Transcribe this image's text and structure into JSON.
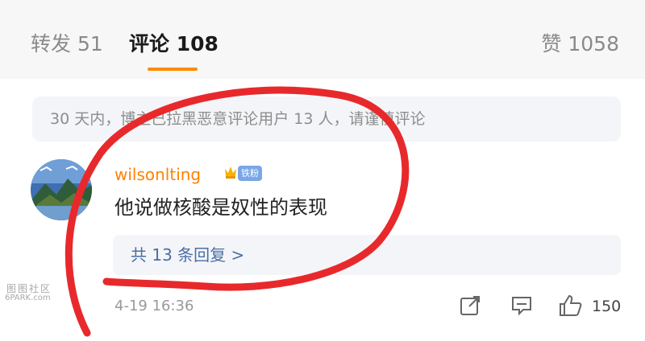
{
  "tabs": {
    "repost": "转发 51",
    "comments": "评论 108",
    "likes": "赞 1058",
    "active_color": "#ff8a00"
  },
  "notice": "30 天内，博主已拉黑恶意评论用户 13 人，请谨慎评论",
  "comment": {
    "username": "wilsonlting",
    "fan_badge": "铁粉",
    "text": "他说做核酸是奴性的表现",
    "replies_link": "共 13 条回复 >",
    "timestamp": "4-19 16:36",
    "like_count": "150",
    "username_color": "#ff8200"
  },
  "icons": {
    "share": "share-icon",
    "comment": "comment-icon",
    "like": "thumbs-up-icon",
    "crown": "crown-badge-icon"
  },
  "watermark": {
    "cn": "图图社区",
    "en": "6PARK.com"
  },
  "annotation_color": "#e8292c"
}
